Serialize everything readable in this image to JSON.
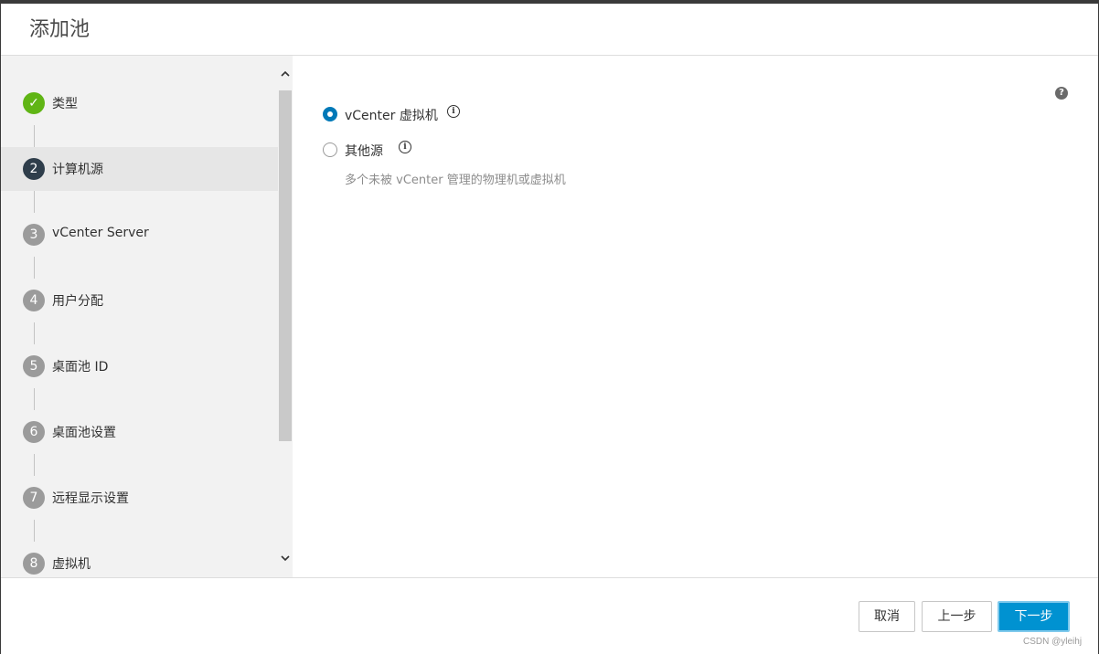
{
  "dialog": {
    "title": "添加池"
  },
  "steps": [
    {
      "number": "✓",
      "label": "类型",
      "state": "done"
    },
    {
      "number": "2",
      "label": "计算机源",
      "state": "active"
    },
    {
      "number": "3",
      "label": "vCenter Server",
      "state": "pending"
    },
    {
      "number": "4",
      "label": "用户分配",
      "state": "pending"
    },
    {
      "number": "5",
      "label": "桌面池 ID",
      "state": "pending"
    },
    {
      "number": "6",
      "label": "桌面池设置",
      "state": "pending"
    },
    {
      "number": "7",
      "label": "远程显示设置",
      "state": "pending"
    },
    {
      "number": "8",
      "label": "虚拟机",
      "state": "pending"
    }
  ],
  "content": {
    "help_icon": "?",
    "options": [
      {
        "label": "vCenter 虚拟机",
        "checked": true,
        "info_icon": "i"
      },
      {
        "label": "其他源",
        "checked": false,
        "info_icon": "i"
      }
    ],
    "other_source_description": "多个未被 vCenter 管理的物理机或虚拟机"
  },
  "footer": {
    "cancel_label": "取消",
    "back_label": "上一步",
    "next_label": "下一步",
    "watermark": "CSDN @yleihj"
  },
  "colors": {
    "accent": "#0079b8",
    "done": "#60b515",
    "active_step": "#2f3e4b",
    "pending_step": "#9b9b9b",
    "primary_button": "#0092d1"
  }
}
